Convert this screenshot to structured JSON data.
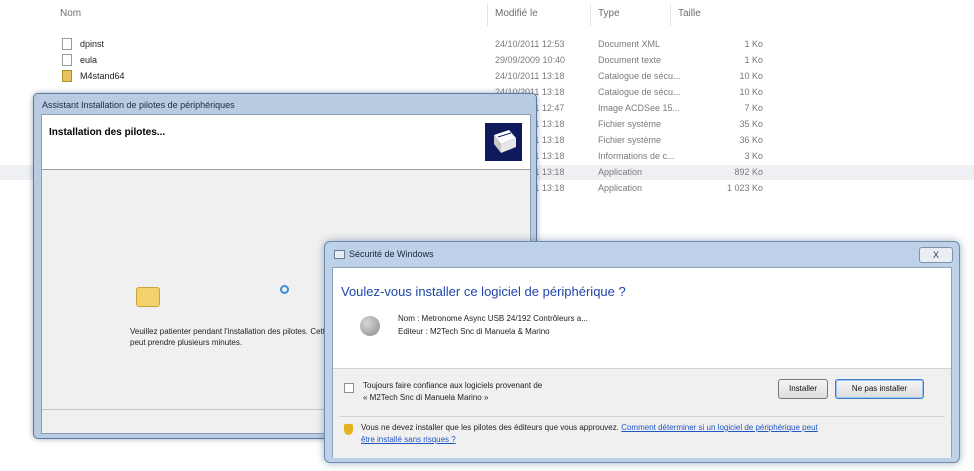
{
  "explorer": {
    "columns": {
      "name": "Nom",
      "modified": "Modifié le",
      "type": "Type",
      "size": "Taille"
    },
    "files": [
      {
        "name": "dpinst",
        "modified": "24/10/2011 12:53",
        "type": "Document XML",
        "size": "1 Ko",
        "icon": "document-icon"
      },
      {
        "name": "eula",
        "modified": "29/09/2009 10:40",
        "type": "Document texte",
        "size": "1 Ko",
        "icon": "document-icon"
      },
      {
        "name": "M4stand64",
        "modified": "24/10/2011 13:18",
        "type": "Catalogue de sécu...",
        "size": "10 Ko",
        "icon": "catalog-icon"
      },
      {
        "name": "",
        "modified": "24/10/2011 13:18",
        "type": "Catalogue de sécu...",
        "size": "10 Ko",
        "icon": "catalog-icon"
      },
      {
        "name": "",
        "modified": "24/10/2011 12:47",
        "type": "Image ACDSee 15...",
        "size": "7 Ko",
        "icon": "image-icon"
      },
      {
        "name": "",
        "modified": "24/10/2011 13:18",
        "type": "Fichier système",
        "size": "35 Ko",
        "icon": "system-file-icon"
      },
      {
        "name": "",
        "modified": "24/10/2011 13:18",
        "type": "Fichier système",
        "size": "36 Ko",
        "icon": "system-file-icon"
      },
      {
        "name": "",
        "modified": "24/10/2011 13:18",
        "type": "Informations de c...",
        "size": "3 Ko",
        "icon": "setup-info-icon"
      },
      {
        "name": "",
        "modified": "24/10/2011 13:18",
        "type": "Application",
        "size": "892 Ko",
        "icon": "application-icon"
      },
      {
        "name": "",
        "modified": "24/10/2011 13:18",
        "type": "Application",
        "size": "1 023 Ko",
        "icon": "application-icon"
      }
    ]
  },
  "wizard": {
    "title": "Assistant Installation de pilotes de périphériques",
    "heading": "Installation des pilotes...",
    "wait_text": "Veuillez patienter pendant l'installation des pilotes. Cette opération peut prendre plusieurs minutes."
  },
  "security": {
    "title": "Sécurité de Windows",
    "close_label": "X",
    "question": "Voulez-vous installer ce logiciel de périphérique ?",
    "device_name": "Nom : Metronome Async USB 24/192 Contrôleurs a...",
    "publisher": "Editeur : M2Tech Snc di Manuela & Marino",
    "trust_line1": "Toujours faire confiance aux logiciels provenant de",
    "trust_line2": "« M2Tech Snc di Manuela Marino »",
    "install_button": "Installer",
    "noinstall_button": "Ne pas installer",
    "warning_text": "Vous ne devez installer que les pilotes des éditeurs que vous approuvez.",
    "warning_link": "Comment déterminer si un logiciel de périphérique peut",
    "warning_link2": "être installé sans risques ?"
  },
  "colors": {
    "wizard_frame": "#b9cbe0",
    "security_frame": "#bdd1e8",
    "question_blue": "#1e47a8",
    "link_blue": "#2155c4",
    "wizard_logo": "#0f1a5c"
  }
}
